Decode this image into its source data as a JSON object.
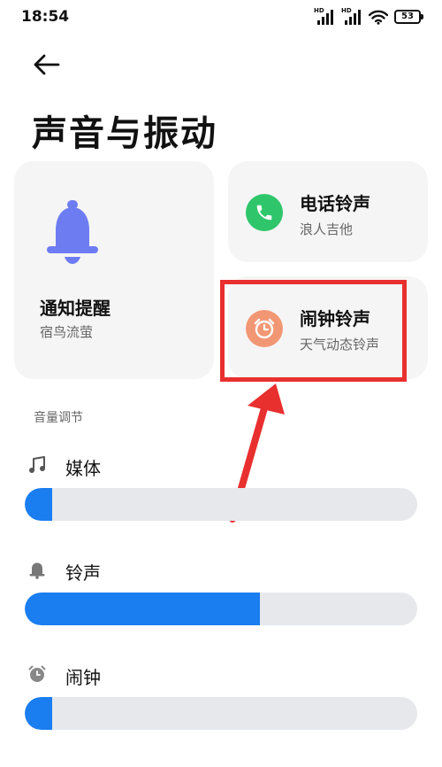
{
  "status_bar": {
    "time": "18:54",
    "signal1_label": "HD",
    "signal2_label": "HD",
    "battery": "53"
  },
  "header": {
    "back_icon": "arrow-left-icon",
    "title": "声音与振动"
  },
  "cards": {
    "notification": {
      "title": "通知提醒",
      "subtitle": "宿鸟流萤",
      "icon": "bell-icon",
      "icon_color": "#6e7cf2"
    },
    "ringtone": {
      "title": "电话铃声",
      "subtitle": "浪人吉他",
      "icon": "phone-icon",
      "icon_color": "#2fc66b"
    },
    "alarm": {
      "title": "闹钟铃声",
      "subtitle": "天气动态铃声",
      "icon": "alarm-clock-icon",
      "icon_color": "#f29774"
    }
  },
  "annotation": {
    "color": "#e8302f"
  },
  "volume": {
    "section_label": "音量调节",
    "accent": "#1a7df0",
    "items": [
      {
        "label": "媒体",
        "icon": "music-note-icon",
        "level": 0.07
      },
      {
        "label": "铃声",
        "icon": "bell-icon",
        "level": 0.6
      },
      {
        "label": "闹钟",
        "icon": "alarm-clock-icon",
        "level": 0.07
      }
    ]
  }
}
